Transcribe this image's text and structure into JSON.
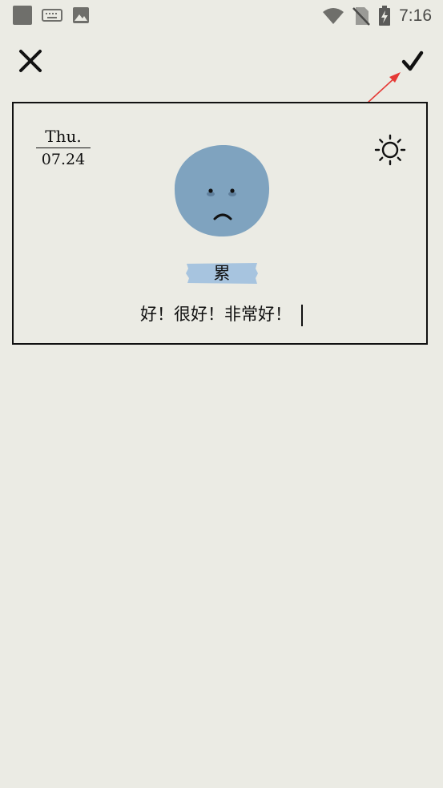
{
  "statusbar": {
    "time": "7:16",
    "icons": [
      "app-square-icon",
      "keyboard-icon",
      "image-icon",
      "wifi-icon",
      "no-sim-icon",
      "battery-charging-icon"
    ]
  },
  "toolbar": {
    "close_icon": "close-icon",
    "confirm_icon": "checkmark-icon"
  },
  "entry": {
    "day": "Thu.",
    "date": "07.24",
    "weather_icon": "sun-icon",
    "mood_icon": "tired-face-icon",
    "mood_label": "累",
    "text": "好！很好！非常好！"
  },
  "colors": {
    "background": "#ebebe4",
    "mood_face": "#7fa3bf",
    "mood_tag": "#a7c4df",
    "annotation_arrow": "#e53935"
  }
}
